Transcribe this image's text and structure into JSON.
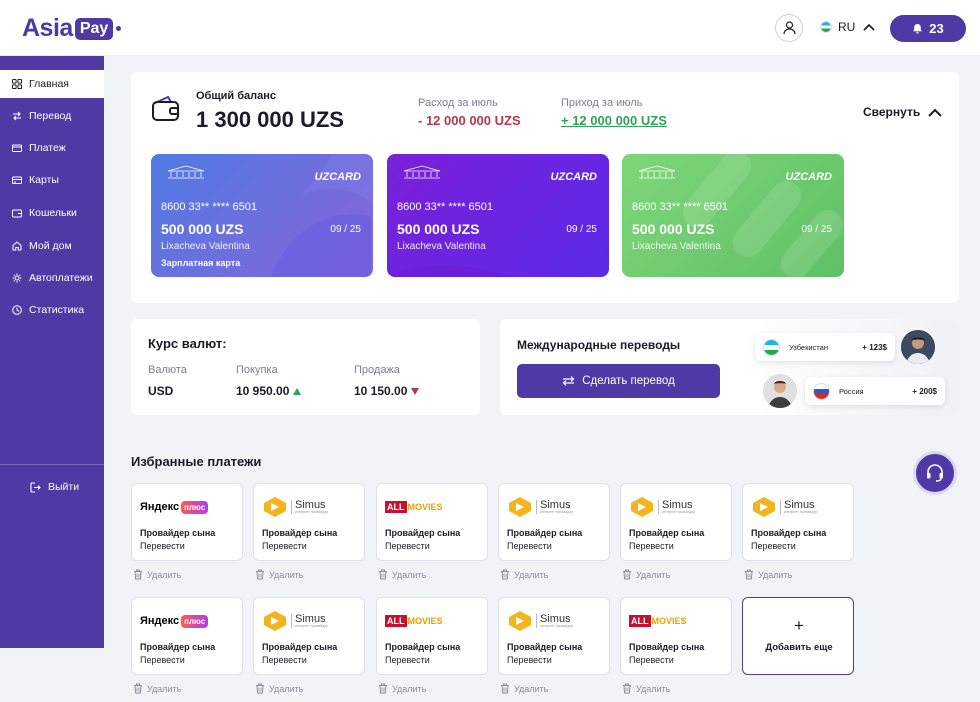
{
  "header": {
    "logo_text": "Asia",
    "logo_badge": "Pay",
    "language": "RU",
    "notifications_count": "23"
  },
  "sidebar": {
    "items": [
      {
        "label": "Главная",
        "icon": "grid-icon"
      },
      {
        "label": "Перевод",
        "icon": "transfer-icon"
      },
      {
        "label": "Платеж",
        "icon": "card-icon"
      },
      {
        "label": "Карты",
        "icon": "cards-icon"
      },
      {
        "label": "Кошельки",
        "icon": "wallet-icon"
      },
      {
        "label": "Мой дом",
        "icon": "home-icon"
      },
      {
        "label": "Автоплатежи",
        "icon": "autopay-icon"
      },
      {
        "label": "Статистика",
        "icon": "stats-icon"
      }
    ],
    "logout": "Выйти"
  },
  "balance": {
    "label": "Общий баланс",
    "value": "1 300 000 UZS",
    "expense_label": "Расход за июль",
    "expense_value": "- 12 000 000 UZS",
    "income_label": "Приход за июль",
    "income_value": "+ 12 000 000 UZS",
    "collapse_label": "Свернуть"
  },
  "cards": [
    {
      "brand": "UZCARD",
      "number": "8600 33** **** 6501",
      "amount": "500 000 UZS",
      "expiry": "09 /  25",
      "holder": "Lixacheva Valentina",
      "type": "Зарплатная карта",
      "color_from": "#4f7be3",
      "color_to": "#8a63d9"
    },
    {
      "brand": "UZCARD",
      "number": "8600 33** **** 6501",
      "amount": "500 000 UZS",
      "expiry": "09 /  25",
      "holder": "Lixacheva Valentina",
      "type": "",
      "color_from": "#7b1fd8",
      "color_to": "#5a2be8"
    },
    {
      "brand": "UZCARD",
      "number": "8600 33** **** 6501",
      "amount": "500 000 UZS",
      "expiry": "09 /  25",
      "holder": "Lixacheva Valentina",
      "type": "",
      "color_from": "#7fd67a",
      "color_to": "#5fc065"
    }
  ],
  "rates": {
    "title": "Курс валют:",
    "col_currency": "Валюта",
    "col_buy": "Покупка",
    "col_sell": "Продажа",
    "currency": "USD",
    "buy": "10 950.00",
    "sell": "10 150.00"
  },
  "international": {
    "title": "Международные переводы",
    "button": "Сделать перевод",
    "pills": [
      {
        "country": "Узбекистан",
        "amount": "+ 123$"
      },
      {
        "country": "Россия",
        "amount": "+ 200$"
      }
    ]
  },
  "favorites": {
    "title": "Избранные платежи",
    "delete_label": "Удалить",
    "add_label": "Добавить еще",
    "items": [
      {
        "logo": "yandex",
        "brand": "Яндекс",
        "badge": "плюс",
        "title": "Провайдер сына",
        "sub": "Перевести"
      },
      {
        "logo": "simus",
        "brand": "Simus",
        "tagline": "интернет провайдер",
        "title": "Провайдер сына",
        "sub": "Перевести"
      },
      {
        "logo": "allmovies",
        "brand_a": "ALL",
        "brand_b": "MOVIES",
        "title": "Провайдер сына",
        "sub": "Перевести"
      },
      {
        "logo": "simus",
        "brand": "Simus",
        "tagline": "интернет провайдер",
        "title": "Провайдер сына",
        "sub": "Перевести"
      },
      {
        "logo": "simus",
        "brand": "Simus",
        "tagline": "интернет провайдер",
        "title": "Провайдер сына",
        "sub": "Перевести"
      },
      {
        "logo": "simus",
        "brand": "Simus",
        "tagline": "интернет провайдер",
        "title": "Провайдер сына",
        "sub": "Перевести"
      },
      {
        "logo": "yandex",
        "brand": "Яндекс",
        "badge": "плюс",
        "title": "Провайдер сына",
        "sub": "Перевести"
      },
      {
        "logo": "simus",
        "brand": "Simus",
        "tagline": "интернет провайдер",
        "title": "Провайдер сына",
        "sub": "Перевести"
      },
      {
        "logo": "allmovies",
        "brand_a": "ALL",
        "brand_b": "MOVIES",
        "title": "Провайдер сына",
        "sub": "Перевести"
      },
      {
        "logo": "simus",
        "brand": "Simus",
        "tagline": "интернет провайдер",
        "title": "Провайдер сына",
        "sub": "Перевести"
      },
      {
        "logo": "allmovies",
        "brand_a": "ALL",
        "brand_b": "MOVIES",
        "title": "Провайдер сына",
        "sub": "Перевести"
      }
    ]
  },
  "colors": {
    "accent": "#4d3aa5",
    "expense": "#b33a48",
    "income": "#2fa35b"
  }
}
